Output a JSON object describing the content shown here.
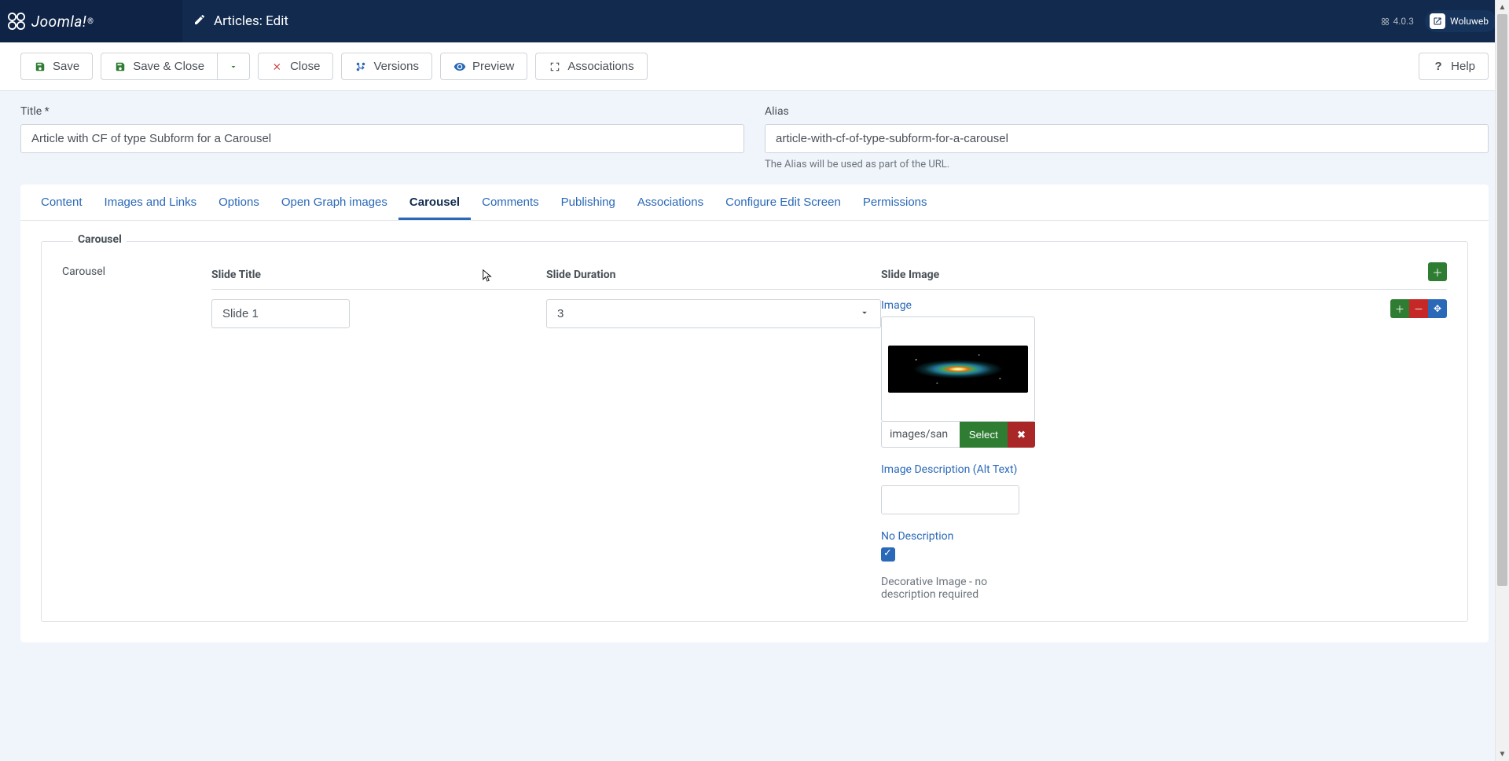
{
  "header": {
    "page_title": "Articles: Edit",
    "version": "4.0.3",
    "username": "Woluweb"
  },
  "toolbar": {
    "save": "Save",
    "save_close": "Save & Close",
    "close": "Close",
    "versions": "Versions",
    "preview": "Preview",
    "associations": "Associations",
    "help": "Help"
  },
  "form": {
    "title_label": "Title",
    "title_value": "Article with CF of type Subform for a Carousel",
    "alias_label": "Alias",
    "alias_value": "article-with-cf-of-type-subform-for-a-carousel",
    "alias_hint": "The Alias will be used as part of the URL."
  },
  "tabs": [
    "Content",
    "Images and Links",
    "Options",
    "Open Graph images",
    "Carousel",
    "Comments",
    "Publishing",
    "Associations",
    "Configure Edit Screen",
    "Permissions"
  ],
  "active_tab": "Carousel",
  "carousel": {
    "legend": "Carousel",
    "field_label": "Carousel",
    "columns": {
      "title": "Slide Title",
      "duration": "Slide Duration",
      "image": "Slide Image"
    },
    "row": {
      "title_value": "Slide 1",
      "duration_value": "3",
      "image_label": "Image",
      "image_path": "images/san",
      "select_label": "Select",
      "alt_label": "Image Description (Alt Text)",
      "alt_value": "",
      "nodesc_label": "No Description",
      "nodesc_checked": true,
      "nodesc_help": "Decorative Image - no description required"
    }
  }
}
